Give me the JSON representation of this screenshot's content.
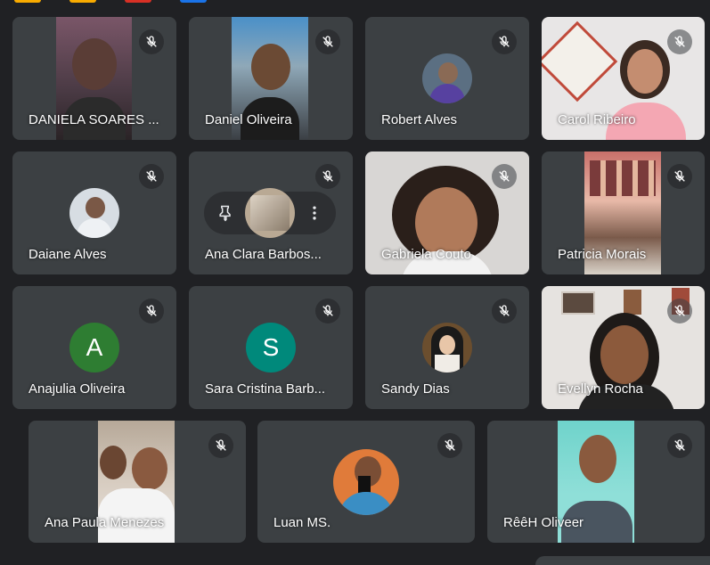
{
  "participants": [
    {
      "name": "DANIELA SOARES ..."
    },
    {
      "name": "Daniel Oliveira"
    },
    {
      "name": "Robert Alves"
    },
    {
      "name": "Carol Ribeiro"
    },
    {
      "name": "Daiane Alves"
    },
    {
      "name": "Ana Clara Barbos..."
    },
    {
      "name": "Gabriela Couto"
    },
    {
      "name": "Patricia Morais"
    },
    {
      "name": "Anajulia Oliveira",
      "initial": "A",
      "avatar_color": "#2e7d32"
    },
    {
      "name": "Sara Cristina Barb...",
      "initial": "S",
      "avatar_color": "#00897b"
    },
    {
      "name": "Sandy Dias"
    },
    {
      "name": "Evellyn Rocha"
    },
    {
      "name": "Ana Paula Menezes"
    },
    {
      "name": "Luan MS."
    },
    {
      "name": "RêêH Oliveer"
    }
  ],
  "icons": {
    "mic": "mic-off-icon",
    "pin": "pin-icon",
    "more": "more-vert-icon"
  },
  "colors": {
    "background": "#202124",
    "tile": "#3c4043"
  }
}
